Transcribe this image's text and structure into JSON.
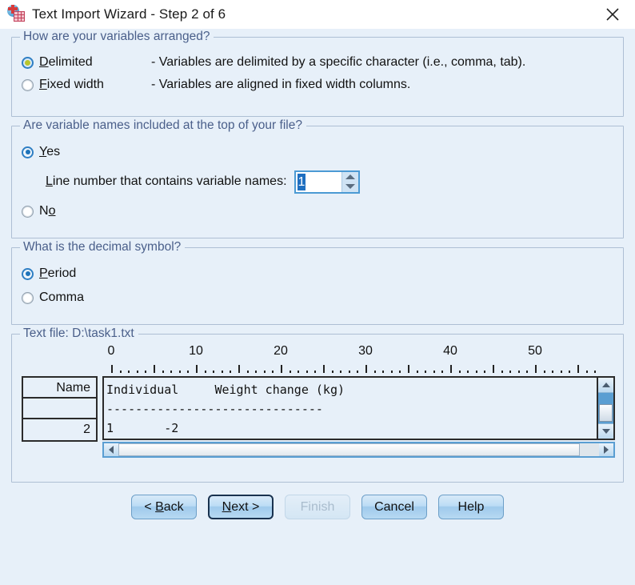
{
  "window": {
    "title": "Text Import Wizard - Step 2 of 6",
    "icon": "spss-text-import-icon",
    "close_label": "✕"
  },
  "group_arrangement": {
    "legend": "How are your variables arranged?",
    "options": [
      {
        "label_pre": "",
        "accel": "D",
        "label_post": "elimited",
        "selected": true,
        "description": "- Variables are delimited by a specific character (i.e., comma, tab)."
      },
      {
        "label_pre": "",
        "accel": "F",
        "label_post": "ixed width",
        "selected": false,
        "description": "- Variables are aligned in fixed width columns."
      }
    ]
  },
  "group_varnames": {
    "legend": "Are variable names included at the top of your file?",
    "yes": {
      "label_pre": "",
      "accel": "Y",
      "label_post": "es",
      "selected": true
    },
    "no": {
      "label_pre": "N",
      "accel": "o",
      "label_post": "",
      "selected": false
    },
    "line_number": {
      "label": "Line number that contains variable names:",
      "accel": "L",
      "value": "1",
      "up_icon": "spinner-up-icon",
      "down_icon": "spinner-down-icon"
    }
  },
  "group_decimal": {
    "legend": "What is the decimal symbol?",
    "options": [
      {
        "label_pre": "",
        "accel": "P",
        "label_post": "eriod",
        "selected": true
      },
      {
        "label_pre": "Comma",
        "accel": "",
        "label_post": "",
        "selected": false
      }
    ]
  },
  "group_preview": {
    "legend": "Text file:  D:\\task1.txt",
    "ruler": {
      "labels": [
        "0",
        "10",
        "20",
        "30",
        "40",
        "50"
      ],
      "label_values": [
        0,
        10,
        20,
        30,
        40,
        50
      ],
      "max": 57,
      "major_every": 5
    },
    "row_headers": [
      "Name",
      "",
      "2"
    ],
    "text_lines": [
      "Individual     Weight change (kg)",
      "------------------------------",
      "1       -2"
    ],
    "vscroll": {
      "up_icon": "scroll-up-icon",
      "down_icon": "scroll-down-icon"
    },
    "hscroll": {
      "left_icon": "scroll-left-icon",
      "right_icon": "scroll-right-icon"
    }
  },
  "buttons": [
    {
      "name": "back-button",
      "pre": "< ",
      "accel": "B",
      "post": "ack",
      "state": "normal"
    },
    {
      "name": "next-button",
      "pre": "",
      "accel": "N",
      "post": "ext >",
      "state": "focused"
    },
    {
      "name": "finish-button",
      "pre": "Finish",
      "accel": "",
      "post": "",
      "state": "disabled"
    },
    {
      "name": "cancel-button",
      "pre": "Cancel",
      "accel": "",
      "post": "",
      "state": "normal"
    },
    {
      "name": "help-button",
      "pre": "Help",
      "accel": "",
      "post": "",
      "state": "normal"
    }
  ],
  "colors": {
    "dialog_bg": "#e7f0f9",
    "legend_text": "#4a5f8a",
    "accent_blue": "#1f6fc0"
  }
}
